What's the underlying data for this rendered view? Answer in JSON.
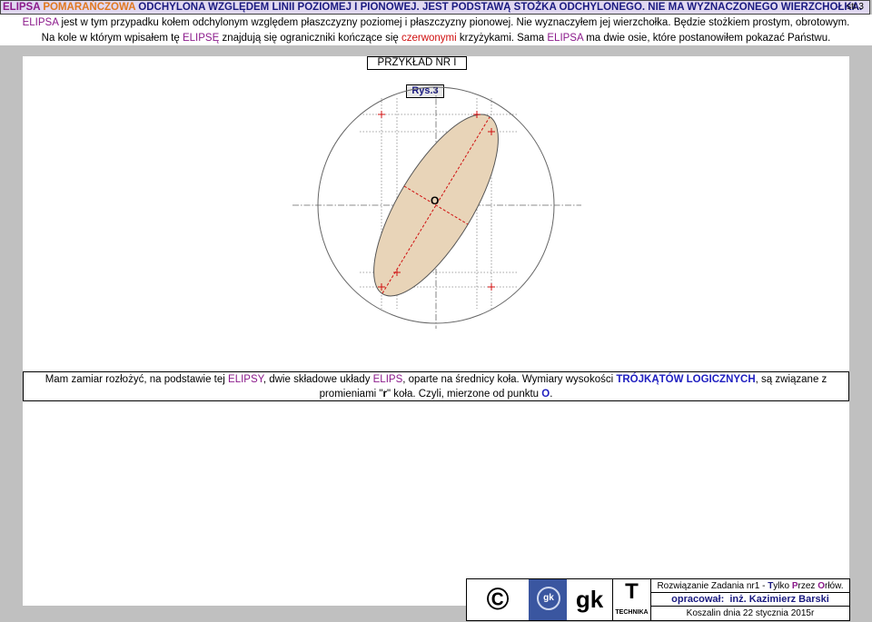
{
  "header": {
    "title_a": "ELIPSA ",
    "title_b": "POMARAŃCZOWA",
    "title_c": " ODCHYLONA WZGLĘDEM LINII POZIOMEJ I PIONOWEJ. JEST PODSTAWĄ STOŻKA ODCHYLONEGO. NIE MA WYZNACZONEGO WIERZCHOŁKA.",
    "page_label": "str.3"
  },
  "intro": {
    "line1_a": "ELIPSA",
    "line1_b": " jest w tym przypadku kołem odchylonym względem płaszczyzny poziomej i płaszczyzny pionowej. Nie wyznaczyłem jej wierzchołka. Będzie stożkiem prostym, obrotowym.",
    "line2_a": "Na kole w którym wpisałem tę ",
    "line2_b": "ELIPSĘ",
    "line2_c": " znajdują się ograniczniki kończące się ",
    "line2_d": "czerwonymi",
    "line2_e": " krzyżykami. Sama ",
    "line2_f": "ELIPSA",
    "line2_g": " ma dwie osie, które postanowiłem pokazać Państwu."
  },
  "example_title": "PRZYKŁAD NR I",
  "figure": {
    "label": "Rys.3",
    "center_label": "O",
    "ellipse_fill": "#e8d4b8",
    "accent_red": "#d01010"
  },
  "note": {
    "l1_a": "Mam zamiar rozłożyć, na podstawie tej ",
    "l1_b": "ELIPSY",
    "l1_c": ", dwie składowe układy ",
    "l1_d": "ELIPS",
    "l1_e": ", oparte na średnicy koła. Wymiary wysokości ",
    "l1_f": "TRÓJKĄTÓW LOGICZNYCH",
    "l1_g": ", są związane z",
    "l2_a": "promieniami \"",
    "l2_b": "r",
    "l2_c": "\" koła. Czyli, mierzone od punktu ",
    "l2_d": "O",
    "l2_e": "."
  },
  "footer": {
    "copyright": "©",
    "logo_text": "gk",
    "gk": "gk",
    "t_big": "T",
    "t_small": "TECHNIKA",
    "row1_a": "Rozwiązanie Zadania nr1 - ",
    "row1_b": "T",
    "row1_c": "ylko ",
    "row1_d": "P",
    "row1_e": "rzez ",
    "row1_f": "O",
    "row1_g": "rłów.",
    "row2_a": "opracował:",
    "row2_b": "inż. Kazimierz Barski",
    "row3": "Koszalin dnia 22 stycznia 2015r"
  }
}
